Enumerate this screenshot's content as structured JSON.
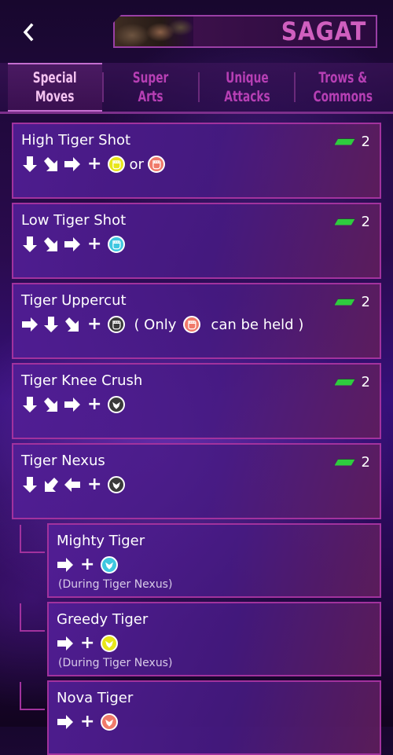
{
  "header": {
    "back_icon": "chevron-left-icon",
    "character_name": "SAGAT"
  },
  "tabs": [
    {
      "line1": "Special",
      "line2": "Moves",
      "active": true
    },
    {
      "line1": "Super",
      "line2": "Arts",
      "active": false
    },
    {
      "line1": "Unique",
      "line2": "Attacks",
      "active": false
    },
    {
      "line1": "Trows &",
      "line2": "Commons",
      "active": false
    }
  ],
  "moves": [
    {
      "name": "High Tiger Shot",
      "meter": "2",
      "or_text": "or"
    },
    {
      "name": "Low Tiger Shot",
      "meter": "2"
    },
    {
      "name": "Tiger Uppercut",
      "meter": "2",
      "only_text": "( Only",
      "held_text": "can be held )"
    },
    {
      "name": "Tiger Knee Crush",
      "meter": "2"
    },
    {
      "name": "Tiger Nexus",
      "meter": "2"
    }
  ],
  "followups": [
    {
      "name": "Mighty Tiger",
      "note": "(During Tiger Nexus)"
    },
    {
      "name": "Greedy Tiger",
      "note": "(During Tiger Nexus)"
    },
    {
      "name": "Nova Tiger",
      "note": ""
    }
  ],
  "colors": {
    "accent_border": "#a2329e",
    "meter_green": "#2ecc3e",
    "punch_light": "#e8e61a",
    "punch_medium": "#3fc7e0",
    "punch_heavy": "#f07a6a",
    "kick_generic": "#3a3a3a"
  },
  "icons": {
    "down_arrow": "arrow-down-icon",
    "downforward_arrow": "arrow-down-right-icon",
    "forward_arrow": "arrow-right-icon",
    "downback_arrow": "arrow-down-left-icon",
    "back_arrow": "arrow-left-icon",
    "light_punch": "light-punch-icon",
    "heavy_punch": "heavy-punch-icon",
    "medium_punch": "medium-punch-icon",
    "punch_any": "punch-any-icon",
    "kick_any": "kick-any-icon",
    "medium_kick": "medium-kick-icon",
    "light_kick": "light-kick-icon",
    "heavy_kick": "heavy-kick-icon",
    "meter": "drive-meter-icon"
  }
}
